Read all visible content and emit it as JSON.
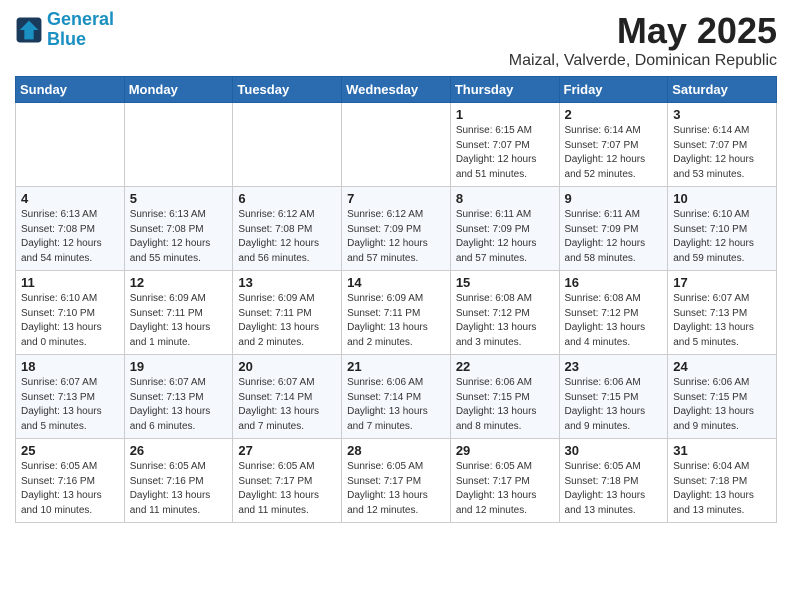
{
  "header": {
    "logo_line1": "General",
    "logo_line2": "Blue",
    "title": "May 2025",
    "subtitle": "Maizal, Valverde, Dominican Republic"
  },
  "weekdays": [
    "Sunday",
    "Monday",
    "Tuesday",
    "Wednesday",
    "Thursday",
    "Friday",
    "Saturday"
  ],
  "weeks": [
    [
      {
        "day": "",
        "info": ""
      },
      {
        "day": "",
        "info": ""
      },
      {
        "day": "",
        "info": ""
      },
      {
        "day": "",
        "info": ""
      },
      {
        "day": "1",
        "info": "Sunrise: 6:15 AM\nSunset: 7:07 PM\nDaylight: 12 hours\nand 51 minutes."
      },
      {
        "day": "2",
        "info": "Sunrise: 6:14 AM\nSunset: 7:07 PM\nDaylight: 12 hours\nand 52 minutes."
      },
      {
        "day": "3",
        "info": "Sunrise: 6:14 AM\nSunset: 7:07 PM\nDaylight: 12 hours\nand 53 minutes."
      }
    ],
    [
      {
        "day": "4",
        "info": "Sunrise: 6:13 AM\nSunset: 7:08 PM\nDaylight: 12 hours\nand 54 minutes."
      },
      {
        "day": "5",
        "info": "Sunrise: 6:13 AM\nSunset: 7:08 PM\nDaylight: 12 hours\nand 55 minutes."
      },
      {
        "day": "6",
        "info": "Sunrise: 6:12 AM\nSunset: 7:08 PM\nDaylight: 12 hours\nand 56 minutes."
      },
      {
        "day": "7",
        "info": "Sunrise: 6:12 AM\nSunset: 7:09 PM\nDaylight: 12 hours\nand 57 minutes."
      },
      {
        "day": "8",
        "info": "Sunrise: 6:11 AM\nSunset: 7:09 PM\nDaylight: 12 hours\nand 57 minutes."
      },
      {
        "day": "9",
        "info": "Sunrise: 6:11 AM\nSunset: 7:09 PM\nDaylight: 12 hours\nand 58 minutes."
      },
      {
        "day": "10",
        "info": "Sunrise: 6:10 AM\nSunset: 7:10 PM\nDaylight: 12 hours\nand 59 minutes."
      }
    ],
    [
      {
        "day": "11",
        "info": "Sunrise: 6:10 AM\nSunset: 7:10 PM\nDaylight: 13 hours\nand 0 minutes."
      },
      {
        "day": "12",
        "info": "Sunrise: 6:09 AM\nSunset: 7:11 PM\nDaylight: 13 hours\nand 1 minute."
      },
      {
        "day": "13",
        "info": "Sunrise: 6:09 AM\nSunset: 7:11 PM\nDaylight: 13 hours\nand 2 minutes."
      },
      {
        "day": "14",
        "info": "Sunrise: 6:09 AM\nSunset: 7:11 PM\nDaylight: 13 hours\nand 2 minutes."
      },
      {
        "day": "15",
        "info": "Sunrise: 6:08 AM\nSunset: 7:12 PM\nDaylight: 13 hours\nand 3 minutes."
      },
      {
        "day": "16",
        "info": "Sunrise: 6:08 AM\nSunset: 7:12 PM\nDaylight: 13 hours\nand 4 minutes."
      },
      {
        "day": "17",
        "info": "Sunrise: 6:07 AM\nSunset: 7:13 PM\nDaylight: 13 hours\nand 5 minutes."
      }
    ],
    [
      {
        "day": "18",
        "info": "Sunrise: 6:07 AM\nSunset: 7:13 PM\nDaylight: 13 hours\nand 5 minutes."
      },
      {
        "day": "19",
        "info": "Sunrise: 6:07 AM\nSunset: 7:13 PM\nDaylight: 13 hours\nand 6 minutes."
      },
      {
        "day": "20",
        "info": "Sunrise: 6:07 AM\nSunset: 7:14 PM\nDaylight: 13 hours\nand 7 minutes."
      },
      {
        "day": "21",
        "info": "Sunrise: 6:06 AM\nSunset: 7:14 PM\nDaylight: 13 hours\nand 7 minutes."
      },
      {
        "day": "22",
        "info": "Sunrise: 6:06 AM\nSunset: 7:15 PM\nDaylight: 13 hours\nand 8 minutes."
      },
      {
        "day": "23",
        "info": "Sunrise: 6:06 AM\nSunset: 7:15 PM\nDaylight: 13 hours\nand 9 minutes."
      },
      {
        "day": "24",
        "info": "Sunrise: 6:06 AM\nSunset: 7:15 PM\nDaylight: 13 hours\nand 9 minutes."
      }
    ],
    [
      {
        "day": "25",
        "info": "Sunrise: 6:05 AM\nSunset: 7:16 PM\nDaylight: 13 hours\nand 10 minutes."
      },
      {
        "day": "26",
        "info": "Sunrise: 6:05 AM\nSunset: 7:16 PM\nDaylight: 13 hours\nand 11 minutes."
      },
      {
        "day": "27",
        "info": "Sunrise: 6:05 AM\nSunset: 7:17 PM\nDaylight: 13 hours\nand 11 minutes."
      },
      {
        "day": "28",
        "info": "Sunrise: 6:05 AM\nSunset: 7:17 PM\nDaylight: 13 hours\nand 12 minutes."
      },
      {
        "day": "29",
        "info": "Sunrise: 6:05 AM\nSunset: 7:17 PM\nDaylight: 13 hours\nand 12 minutes."
      },
      {
        "day": "30",
        "info": "Sunrise: 6:05 AM\nSunset: 7:18 PM\nDaylight: 13 hours\nand 13 minutes."
      },
      {
        "day": "31",
        "info": "Sunrise: 6:04 AM\nSunset: 7:18 PM\nDaylight: 13 hours\nand 13 minutes."
      }
    ]
  ]
}
